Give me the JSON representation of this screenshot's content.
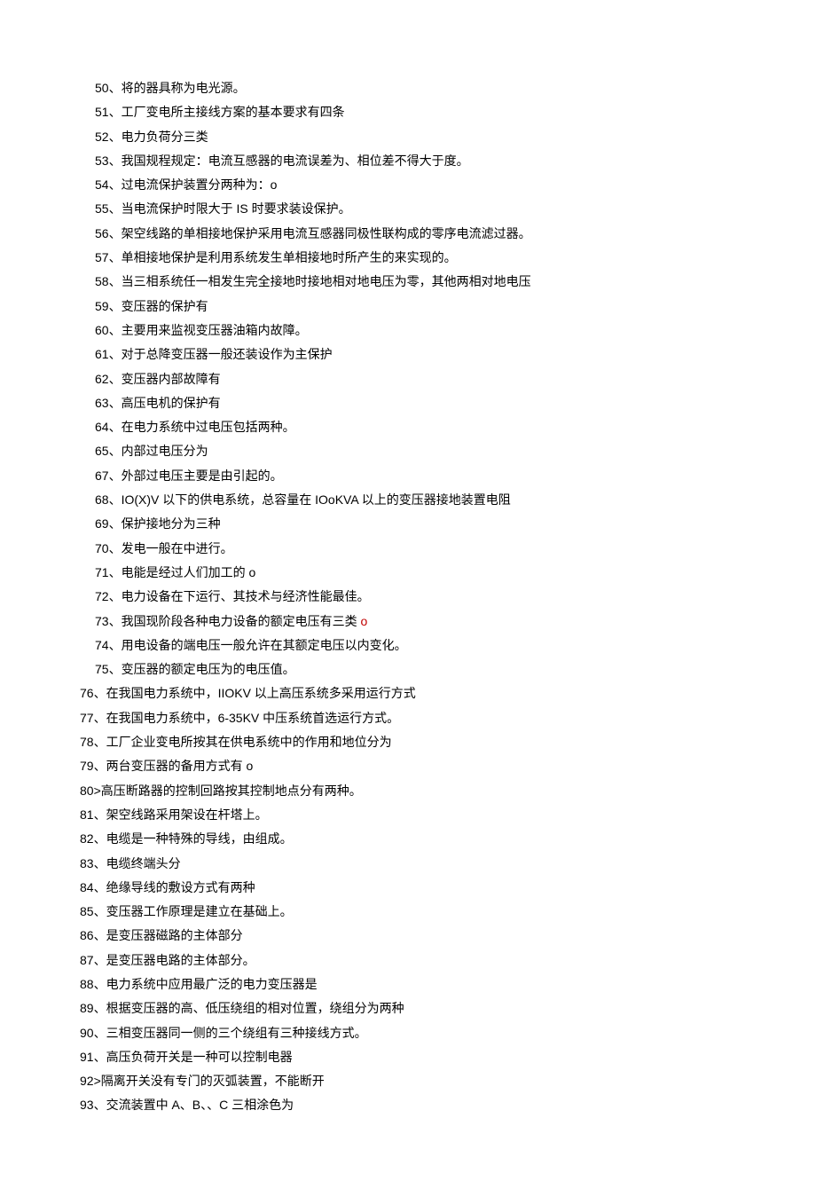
{
  "items": [
    {
      "n": "50",
      "sep": "、",
      "text": "将的器具称为电光源。",
      "indent": "a"
    },
    {
      "n": "51",
      "sep": "、",
      "text": "工厂变电所主接线方案的基本要求有四条",
      "indent": "a"
    },
    {
      "n": "52",
      "sep": "、",
      "text": "电力负荷分三类",
      "indent": "a"
    },
    {
      "n": "53",
      "sep": "、",
      "text": "我国规程规定：电流互感器的电流误差为、相位差不得大于度。",
      "indent": "a"
    },
    {
      "n": "54",
      "sep": "、",
      "text": "过电流保护装置分两种为：o",
      "indent": "a"
    },
    {
      "n": "55",
      "sep": "、",
      "text": "当电流保护时限大于 IS 时要求装设保护。",
      "indent": "a"
    },
    {
      "n": "56",
      "sep": "、",
      "text": "架空线路的单相接地保护采用电流互感器同极性联构成的零序电流滤过器。",
      "indent": "a"
    },
    {
      "n": "57",
      "sep": "、",
      "text": "单相接地保护是利用系统发生单相接地时所产生的来实现的。",
      "indent": "a"
    },
    {
      "n": "58",
      "sep": "、",
      "text": "当三相系统任一相发生完全接地时接地相对地电压为零，其他两相对地电压",
      "indent": "a"
    },
    {
      "n": "59",
      "sep": "、",
      "text": "变压器的保护有",
      "indent": "a"
    },
    {
      "n": "60",
      "sep": "、",
      "text": "主要用来监视变压器油箱内故障。",
      "indent": "a"
    },
    {
      "n": "61",
      "sep": "、",
      "text": "对于总降变压器一般还装设作为主保护",
      "indent": "a"
    },
    {
      "n": "62",
      "sep": "、",
      "text": "变压器内部故障有",
      "indent": "a"
    },
    {
      "n": "63",
      "sep": "、",
      "text": "高压电机的保护有",
      "indent": "a"
    },
    {
      "n": "64",
      "sep": "、",
      "text": "在电力系统中过电压包括两种。",
      "indent": "a"
    },
    {
      "n": "65",
      "sep": "、",
      "text": "内部过电压分为",
      "indent": "a"
    },
    {
      "n": "67",
      "sep": "、",
      "text": "外部过电压主要是由引起的。",
      "indent": "a"
    },
    {
      "n": "68",
      "sep": "、",
      "text": "IO(X)V 以下的供电系统，总容量在 IOoKVA 以上的变压器接地装置电阻",
      "indent": "a"
    },
    {
      "n": "69",
      "sep": "、",
      "text": "保护接地分为三种",
      "indent": "a"
    },
    {
      "n": "70",
      "sep": "、",
      "text": "发电一般在中进行。",
      "indent": "a"
    },
    {
      "n": "71",
      "sep": "、",
      "text": "电能是经过人们加工的 o",
      "indent": "a"
    },
    {
      "n": "72",
      "sep": "、",
      "text": "电力设备在下运行、其技术与经济性能最佳。",
      "indent": "a"
    },
    {
      "n": "73",
      "sep": "、",
      "text": "我国现阶段各种电力设备的额定电压有三类",
      "indent": "a",
      "trail": " o",
      "trail_red": true
    },
    {
      "n": "74",
      "sep": "、",
      "text": "用电设备的端电压一般允许在其额定电压以内变化。",
      "indent": "a"
    },
    {
      "n": "75",
      "sep": "、",
      "text": "变压器的额定电压为的电压值。",
      "indent": "a"
    },
    {
      "n": "76",
      "sep": "、",
      "text": "在我国电力系统中，IIOKV 以上高压系统多采用运行方式",
      "indent": "b"
    },
    {
      "n": "77",
      "sep": "、",
      "text": "在我国电力系统中，6-35KV 中压系统首选运行方式。",
      "indent": "b"
    },
    {
      "n": "78",
      "sep": "、",
      "text": "工厂企业变电所按其在供电系统中的作用和地位分为",
      "indent": "b"
    },
    {
      "n": "79",
      "sep": "、",
      "text": "两台变压器的备用方式有 o",
      "indent": "b"
    },
    {
      "n": "80",
      "sep": ">",
      "text": "高压断路器的控制回路按其控制地点分有两种。",
      "indent": "b"
    },
    {
      "n": "81",
      "sep": "、",
      "text": "架空线路采用架设在杆塔上。",
      "indent": "b"
    },
    {
      "n": "82",
      "sep": "、",
      "text": "电缆是一种特殊的导线，由组成。",
      "indent": "b"
    },
    {
      "n": "83",
      "sep": "、",
      "text": "电缆终端头分",
      "indent": "b"
    },
    {
      "n": "84",
      "sep": "、",
      "text": "绝缘导线的敷设方式有两种",
      "indent": "b"
    },
    {
      "n": "85",
      "sep": "、",
      "text": "变压器工作原理是建立在基础上。",
      "indent": "b"
    },
    {
      "n": "86",
      "sep": "、",
      "text": "是变压器磁路的主体部分",
      "indent": "b"
    },
    {
      "n": "87",
      "sep": "、",
      "text": "是变压器电路的主体部分。",
      "indent": "b"
    },
    {
      "n": "88",
      "sep": "、",
      "text": "电力系统中应用最广泛的电力变压器是",
      "indent": "b"
    },
    {
      "n": "89",
      "sep": "、",
      "text": "根据变压器的高、低压绕组的相对位置，绕组分为两种",
      "indent": "b"
    },
    {
      "n": "90",
      "sep": "、",
      "text": "三相变压器同一侧的三个绕组有三种接线方式。",
      "indent": "b"
    },
    {
      "n": "91",
      "sep": "、",
      "text": "高压负荷开关是一种可以控制电器",
      "indent": "b"
    },
    {
      "n": "92",
      "sep": ">",
      "text": "隔离开关没有专门的灭弧装置，不能断开",
      "indent": "b"
    },
    {
      "n": "93",
      "sep": "、",
      "text": "交流装置中 A、B、、C 三相涂色为",
      "indent": "b"
    }
  ]
}
